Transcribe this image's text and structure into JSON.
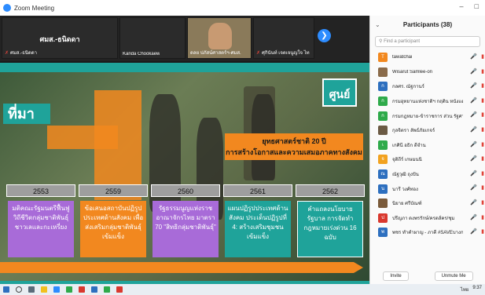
{
  "window": {
    "title": "Zoom Meeting",
    "controls": [
      "–",
      "□"
    ]
  },
  "strip": {
    "main_tile": {
      "name": "ศมส.-ธนิดดา",
      "label": "ศมส.-ธนิดดา"
    },
    "tiles": [
      {
        "label": "Kanda Chookaew"
      },
      {
        "label": "ดลย ปภัสน์ศาสตร์ฯ-ศมส."
      },
      {
        "label": "ศุกินันท์ เจตเจนูญใจ ไท"
      }
    ]
  },
  "slide": {
    "heading": "ที่มา",
    "logo": "ศูนย์",
    "callout": "ยุทธศาสตร์ชาติ 20 ปี\nการสร้างโอกาสและความเสมอภาคทางสังคม",
    "years": [
      "2553",
      "2559",
      "2560",
      "2561",
      "2562"
    ],
    "cards": [
      {
        "text": "มติคณะรัฐมนตรีฟื้นฟูวิถีชีวิตกลุ่มชาติพันธุ์ชาวเลและกะเหรี่ยง",
        "color": "#a86bd8"
      },
      {
        "text": "ข้อเสนอสถาบันปฏิรูปประเทศด้านสังคม เพื่อส่งเสริมกลุ่มชาติพันธุ์เข้มแข็ง",
        "color": "#f2881f"
      },
      {
        "text": "รัฐธรรมนูญแห่งราชอาณาจักรไทย มาตรา 70 \"สิทธิกลุ่มชาติพันธุ์\"",
        "color": "#a86bd8"
      },
      {
        "text": "แผนปฏิรูปประเทศด้านสังคม ประเด็นปฏิรูปที่ 4: สร้างเสริมชุมชนเข้มแข็ง",
        "color": "#1fa39a"
      },
      {
        "text": "คำแถลงนโยบายรัฐบาล การจัดทำกฎหมายเร่งด่วน 16 ฉบับ",
        "color": "#1fa39a"
      }
    ]
  },
  "participants": {
    "title": "Participants (38)",
    "search_placeholder": "Find a participant",
    "list": [
      {
        "name": "tawatchai",
        "avatar": "T",
        "color": "#f2881f"
      },
      {
        "name": "Wisarut Samlee-on",
        "avatar": "",
        "color": "#8a6b4a"
      },
      {
        "name": "กลศร. ณัฐกานร์",
        "avatar": "ก",
        "color": "#2d6fbf"
      },
      {
        "name": "กรมอุทยานแห่งชาติฯ กฤติน หนังแดง...",
        "avatar": "ก",
        "color": "#2eaa4a"
      },
      {
        "name": "กรมกฎหมาย-ข้าราชการ ส่วน รัฐศาสตร์...",
        "avatar": "ก",
        "color": "#2eaa4a"
      },
      {
        "name": "กุลจิตรา ลัพธ์ภัยเกจร์",
        "avatar": "",
        "color": "#6b5a44"
      },
      {
        "name": "เกศินี อธิก ดีจำน",
        "avatar": "เ",
        "color": "#2eaa4a"
      },
      {
        "name": "จุติถีร์ เกษมนนิ",
        "avatar": "จ",
        "color": "#f2a21f"
      },
      {
        "name": "ณัฐวุฒิ ถุงปัน",
        "avatar": "ณ",
        "color": "#2d6fbf"
      },
      {
        "name": "นารี วงศ์ทอง",
        "avatar": "น",
        "color": "#2d6fbf"
      },
      {
        "name": "นิยาย ศรีบัณฑ์",
        "avatar": "",
        "color": "#7a5a3a"
      },
      {
        "name": "ปรีญภา ดงพรรักษ์/ครดส์คร/ชุม",
        "avatar": "ป",
        "color": "#d9382e"
      },
      {
        "name": "พชร ทำคำผาญ - ภาคี #SAVEบางกลอย...",
        "avatar": "พ",
        "color": "#2d6fbf"
      }
    ],
    "invite": "Invite",
    "unmute": "Unmute Me"
  },
  "taskbar": {
    "time": "9:37",
    "lang": "ไทย"
  }
}
